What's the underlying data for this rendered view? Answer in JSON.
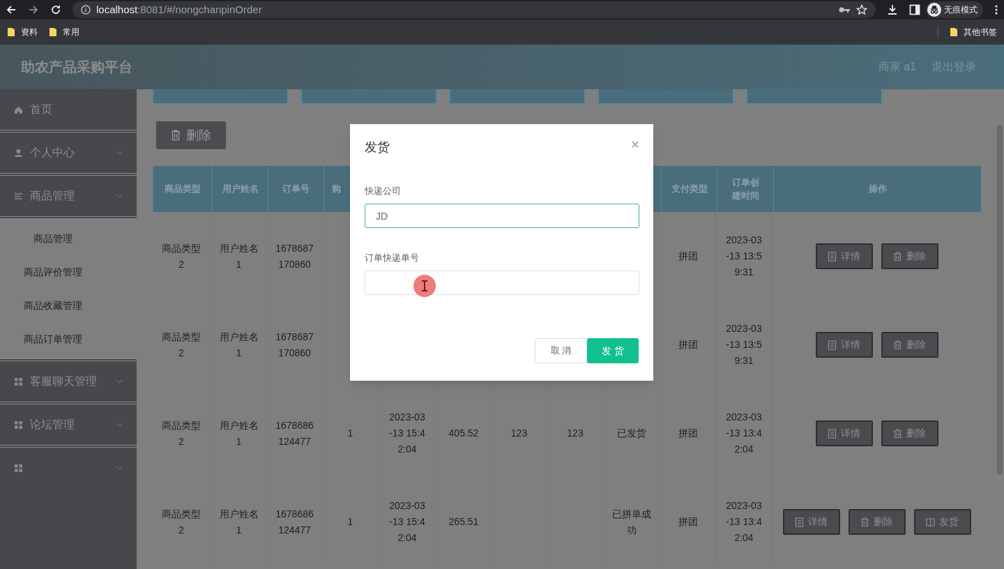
{
  "browser": {
    "url_host": "localhost",
    "url_rest": ":8081/#/nongchanpinOrder",
    "profile": "无痕模式",
    "bookmarks": [
      "资料",
      "常用"
    ],
    "other_bookmarks": "其他书签"
  },
  "header": {
    "title": "助农产品采购平台",
    "user": "商家 a1",
    "logout": "退出登录"
  },
  "sidebar": {
    "items": [
      {
        "label": "首页",
        "kind": "home",
        "expandable": false
      },
      {
        "label": "个人中心",
        "kind": "user",
        "expandable": true
      },
      {
        "label": "商品管理",
        "kind": "list",
        "expandable": true,
        "children": [
          {
            "label": "商品管理",
            "kind": "indented"
          },
          {
            "label": "商品评价管理",
            "kind": "plain"
          },
          {
            "label": "商品收藏管理",
            "kind": "plain"
          },
          {
            "label": "商品订单管理",
            "kind": "plain"
          }
        ]
      },
      {
        "label": "客服聊天管理",
        "kind": "grid",
        "expandable": true
      },
      {
        "label": "论坛管理",
        "kind": "grid",
        "expandable": true
      },
      {
        "kind": "grid",
        "expandable": true
      }
    ]
  },
  "toolbar": {
    "delete_button": "删除"
  },
  "table": {
    "columns": [
      "商品类型",
      "用户姓名",
      "订单号",
      "购",
      "",
      "",
      "",
      "",
      "",
      "支付类型",
      "订单创建时间",
      "操作"
    ],
    "rows": [
      {
        "cells": [
          "商品类型2",
          "用户姓名1",
          "1678687170860",
          "",
          "",
          "",
          "",
          "",
          "",
          "拼团",
          "2023-03-13 13:59:31"
        ],
        "actions": [
          {
            "kind": "detail",
            "label": "详情"
          },
          {
            "kind": "delete",
            "label": "删除"
          }
        ]
      },
      {
        "cells": [
          "商品类型2",
          "用户姓名1",
          "1678687170860",
          "",
          "",
          "",
          "",
          "",
          "",
          "拼团",
          "2023-03-13 13:59:31"
        ],
        "actions": [
          {
            "kind": "detail",
            "label": "详情"
          },
          {
            "kind": "delete",
            "label": "删除"
          }
        ]
      },
      {
        "cells": [
          "商品类型2",
          "用户姓名1",
          "1678686124477",
          "1",
          "2023-03-13 15:42:04",
          "405.52",
          "123",
          "123",
          "已发货",
          "拼团",
          "2023-03-13 13:42:04"
        ],
        "actions": [
          {
            "kind": "detail",
            "label": "详情"
          },
          {
            "kind": "delete",
            "label": "删除"
          }
        ]
      },
      {
        "cells": [
          "商品类型2",
          "用户姓名1",
          "1678686124477",
          "1",
          "2023-03-13 15:42:04",
          "265.51",
          "",
          "",
          "已拼单成功",
          "拼团",
          "2023-03-13 13:42:04"
        ],
        "actions": [
          {
            "kind": "detail",
            "label": "详情"
          },
          {
            "kind": "delete",
            "label": "删除"
          },
          {
            "kind": "ship",
            "label": "发货"
          }
        ]
      }
    ]
  },
  "dialog": {
    "title": "发货",
    "close": "×",
    "fields": [
      {
        "label": "快递公司",
        "value": "JD",
        "active": true
      },
      {
        "label": "订单快递单号",
        "active": false
      }
    ],
    "cancel": "取 消",
    "confirm": "发 货"
  }
}
